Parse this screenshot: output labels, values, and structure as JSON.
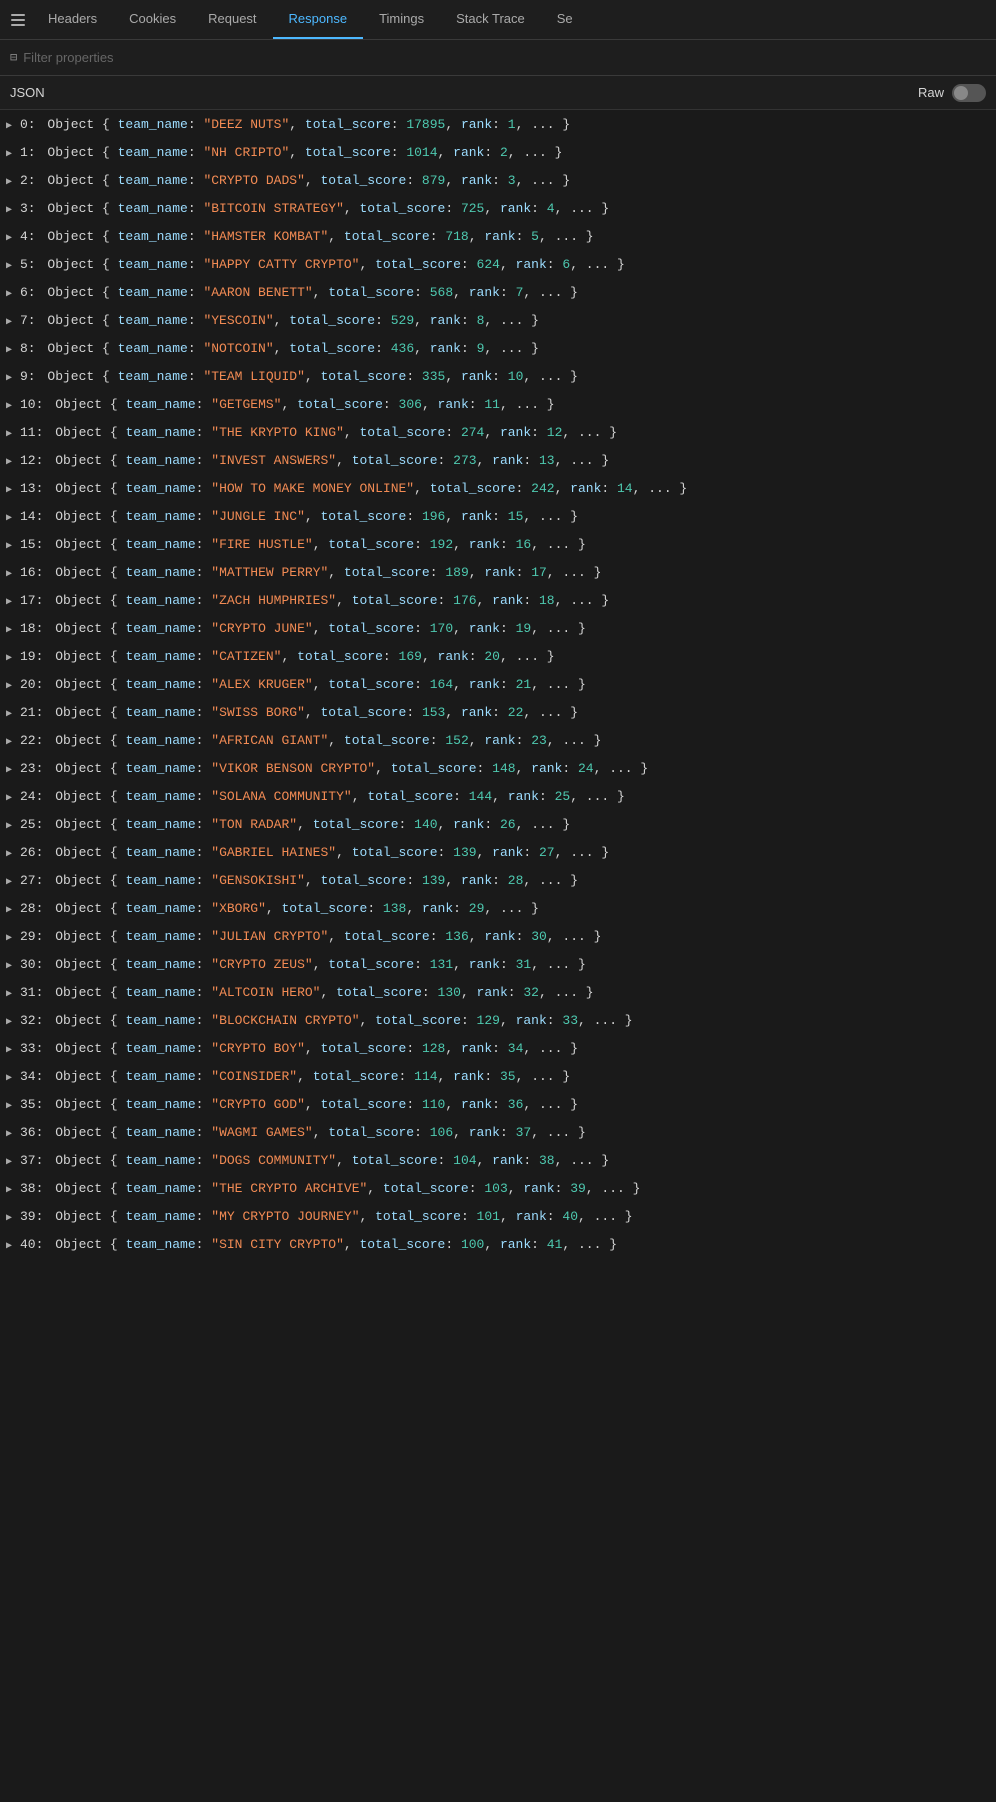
{
  "tabs": [
    {
      "id": "headers",
      "label": "Headers",
      "active": false
    },
    {
      "id": "cookies",
      "label": "Cookies",
      "active": false
    },
    {
      "id": "request",
      "label": "Request",
      "active": false
    },
    {
      "id": "response",
      "label": "Response",
      "active": true
    },
    {
      "id": "timings",
      "label": "Timings",
      "active": false
    },
    {
      "id": "stacktrace",
      "label": "Stack Trace",
      "active": false
    },
    {
      "id": "se",
      "label": "Se",
      "active": false
    }
  ],
  "filter": {
    "placeholder": "Filter properties"
  },
  "json_header": {
    "label": "JSON",
    "raw_label": "Raw"
  },
  "items": [
    {
      "index": 0,
      "team_name": "DEEZ NUTS",
      "total_score": 17895,
      "rank": 1
    },
    {
      "index": 1,
      "team_name": "NH CRIPTO",
      "total_score": 1014,
      "rank": 2
    },
    {
      "index": 2,
      "team_name": "CRYPTO DADS",
      "total_score": 879,
      "rank": 3
    },
    {
      "index": 3,
      "team_name": "BITCOIN STRATEGY",
      "total_score": 725,
      "rank": 4
    },
    {
      "index": 4,
      "team_name": "HAMSTER KOMBAT",
      "total_score": 718,
      "rank": 5
    },
    {
      "index": 5,
      "team_name": "HAPPY CATTY CRYPTO",
      "total_score": 624,
      "rank": 6
    },
    {
      "index": 6,
      "team_name": "AARON BENETT",
      "total_score": 568,
      "rank": 7
    },
    {
      "index": 7,
      "team_name": "YESCOIN",
      "total_score": 529,
      "rank": 8
    },
    {
      "index": 8,
      "team_name": "NOTCOIN",
      "total_score": 436,
      "rank": 9
    },
    {
      "index": 9,
      "team_name": "TEAM LIQUID",
      "total_score": 335,
      "rank": 10
    },
    {
      "index": 10,
      "team_name": "GETGEMS",
      "total_score": 306,
      "rank": 11
    },
    {
      "index": 11,
      "team_name": "THE KRYPTO KING",
      "total_score": 274,
      "rank": 12
    },
    {
      "index": 12,
      "team_name": "INVEST ANSWERS",
      "total_score": 273,
      "rank": 13
    },
    {
      "index": 13,
      "team_name": "HOW TO MAKE MONEY ONLINE",
      "total_score": 242,
      "rank": 14
    },
    {
      "index": 14,
      "team_name": "JUNGLE INC",
      "total_score": 196,
      "rank": 15
    },
    {
      "index": 15,
      "team_name": "FIRE HUSTLE",
      "total_score": 192,
      "rank": 16
    },
    {
      "index": 16,
      "team_name": "MATTHEW PERRY",
      "total_score": 189,
      "rank": 17
    },
    {
      "index": 17,
      "team_name": "ZACH HUMPHRIES",
      "total_score": 176,
      "rank": 18
    },
    {
      "index": 18,
      "team_name": "CRYPTO JUNE",
      "total_score": 170,
      "rank": 19
    },
    {
      "index": 19,
      "team_name": "CATIZEN",
      "total_score": 169,
      "rank": 20
    },
    {
      "index": 20,
      "team_name": "ALEX KRUGER",
      "total_score": 164,
      "rank": 21
    },
    {
      "index": 21,
      "team_name": "SWISS BORG",
      "total_score": 153,
      "rank": 22
    },
    {
      "index": 22,
      "team_name": "AFRICAN GIANT",
      "total_score": 152,
      "rank": 23
    },
    {
      "index": 23,
      "team_name": "VIKOR BENSON CRYPTO",
      "total_score": 148,
      "rank": 24
    },
    {
      "index": 24,
      "team_name": "SOLANA COMMUNITY",
      "total_score": 144,
      "rank": 25
    },
    {
      "index": 25,
      "team_name": "TON RADAR",
      "total_score": 140,
      "rank": 26
    },
    {
      "index": 26,
      "team_name": "GABRIEL HAINES",
      "total_score": 139,
      "rank": 27
    },
    {
      "index": 27,
      "team_name": "GENSOKISHI",
      "total_score": 139,
      "rank": 28
    },
    {
      "index": 28,
      "team_name": "XBORG",
      "total_score": 138,
      "rank": 29
    },
    {
      "index": 29,
      "team_name": "JULIAN CRYPTO",
      "total_score": 136,
      "rank": 30
    },
    {
      "index": 30,
      "team_name": "CRYPTO ZEUS",
      "total_score": 131,
      "rank": 31
    },
    {
      "index": 31,
      "team_name": "ALTCOIN HERO",
      "total_score": 130,
      "rank": 32
    },
    {
      "index": 32,
      "team_name": "BLOCKCHAIN CRYPTO",
      "total_score": 129,
      "rank": 33
    },
    {
      "index": 33,
      "team_name": "CRYPTO BOY",
      "total_score": 128,
      "rank": 34
    },
    {
      "index": 34,
      "team_name": "COINSIDER",
      "total_score": 114,
      "rank": 35
    },
    {
      "index": 35,
      "team_name": "CRYPTO GOD",
      "total_score": 110,
      "rank": 36
    },
    {
      "index": 36,
      "team_name": "WAGMI GAMES",
      "total_score": 106,
      "rank": 37
    },
    {
      "index": 37,
      "team_name": "DOGS COMMUNITY",
      "total_score": 104,
      "rank": 38
    },
    {
      "index": 38,
      "team_name": "THE CRYPTO ARCHIVE",
      "total_score": 103,
      "rank": 39
    },
    {
      "index": 39,
      "team_name": "MY CRYPTO JOURNEY",
      "total_score": 101,
      "rank": 40
    },
    {
      "index": 40,
      "team_name": "SIN CITY CRYPTO",
      "total_score": 100,
      "rank": 41
    }
  ]
}
